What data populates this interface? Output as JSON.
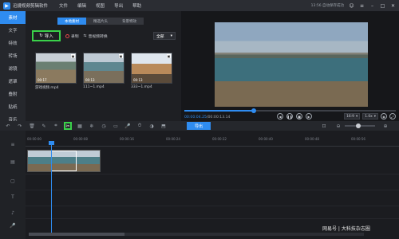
{
  "app": {
    "title": "迅捷视频剪辑软件"
  },
  "menu": [
    "文件",
    "编辑",
    "视图",
    "导出",
    "帮助"
  ],
  "titlebar": {
    "status": "13:56 自动保存成功"
  },
  "sidebar": {
    "items": [
      "素材",
      "文字",
      "特效",
      "转场",
      "滤镜",
      "遮罩",
      "叠附",
      "贴纸",
      "音乐"
    ],
    "active_index": 0
  },
  "media": {
    "tabs": [
      "本地素材",
      "精选片头",
      "背景特效"
    ],
    "active_tab": 0,
    "import_label": "导入",
    "record_label": "录制",
    "convert_label": "音视频转换",
    "filter_value": "全部",
    "thumbnails": [
      {
        "name": "游戏视频.mp4",
        "duration": "00:17"
      },
      {
        "name": "111~1.mp4",
        "duration": "00:13"
      },
      {
        "name": "333~1.mp4",
        "duration": "00:13"
      }
    ]
  },
  "preview": {
    "current_time": "00:00:04.25",
    "total_time": "00:00:13.14",
    "aspect": "16:9",
    "speed": "1.0x",
    "progress": 0.33
  },
  "edit_toolbar": {
    "export_label": "导出"
  },
  "timeline": {
    "ruler": [
      "00:00:00",
      "00:00:08",
      "00:00:16",
      "00:00:24",
      "00:00:32",
      "00:00:40",
      "00:00:48",
      "00:00:56"
    ]
  },
  "watermark": "网易号 | 大科技杂志圈",
  "colors": {
    "accent": "#2f8cf0",
    "highlight": "#3ad14a",
    "bg": "#1e1f23"
  }
}
